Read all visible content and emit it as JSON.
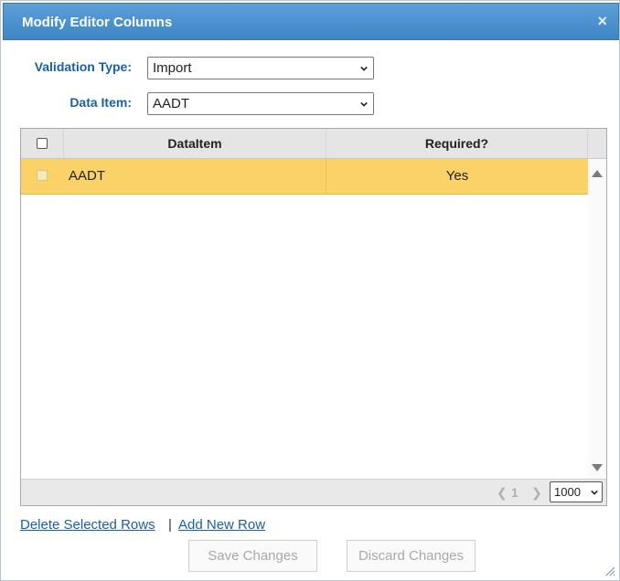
{
  "dialog": {
    "title": "Modify Editor Columns",
    "close_glyph": "×"
  },
  "form": {
    "validation_type": {
      "label": "Validation Type:",
      "value": "Import"
    },
    "data_item": {
      "label": "Data Item:",
      "value": "AADT"
    }
  },
  "grid": {
    "columns": [
      "DataItem",
      "Required?"
    ],
    "rows": [
      {
        "data_item": "AADT",
        "required": "Yes",
        "selected": true
      }
    ],
    "pager": {
      "prev_glyph": "❮",
      "next_glyph": "❯",
      "current_page": "1",
      "page_size": "1000"
    }
  },
  "actions": {
    "delete_link": "Delete Selected Rows",
    "separator": "|",
    "add_link": "Add New Row",
    "save_label": "Save Changes",
    "discard_label": "Discard Changes"
  },
  "colors": {
    "title_bar": "#4a90d0",
    "label_blue": "#1a5fa8",
    "selected_row": "#fbd267",
    "header_bg": "#e5e5e5"
  },
  "icons": [
    "close-icon",
    "chevron-down-icon",
    "scroll-up-icon",
    "scroll-down-icon",
    "resize-grip-icon"
  ]
}
